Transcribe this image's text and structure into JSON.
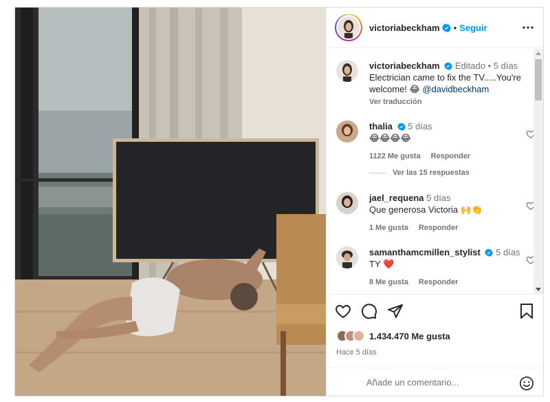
{
  "post": {
    "author": "victoriabeckham",
    "separator": "•",
    "follow_label": "Seguir",
    "caption_edited": "Editado",
    "caption_dot": "•",
    "caption_time": "5 días",
    "caption_text": "Electrician came to fix the TV.....You're welcome! 😂",
    "caption_mention": "@davidbeckham",
    "translate_label": "Ver traducción"
  },
  "comments": [
    {
      "user": "thalia",
      "time": "5 días",
      "text": "😂😂😂😂",
      "likes": "1122 Me gusta",
      "reply_label": "Responder",
      "verified": true
    },
    {
      "user": "jael_requena",
      "time": "5 días",
      "text": "Que generosa Victoria 🙌👏",
      "likes": "1 Me gusta",
      "reply_label": "Responder",
      "verified": false
    },
    {
      "user": "samanthamcmillen_stylist",
      "time": "5 días",
      "text": "TY ❤️",
      "likes": "8 Me gusta",
      "reply_label": "Responder",
      "verified": true
    }
  ],
  "view_replies_label": "Ver las 15 respuestas",
  "footer": {
    "likes_count": "1.434.470 Me gusta",
    "posted_time": "Hace 5 días",
    "comment_placeholder": "Añade un comentario..."
  },
  "icons": {
    "like": "heart-icon",
    "comment": "comment-bubble-icon",
    "share": "paper-plane-icon",
    "save": "bookmark-icon",
    "more": "more-dots-icon",
    "emoji": "emoji-smiley-icon",
    "verified": "verified-badge-icon"
  },
  "colors": {
    "accent": "#0095f6",
    "text": "#262626",
    "muted": "#737373",
    "heart_red": "#ed4956"
  }
}
